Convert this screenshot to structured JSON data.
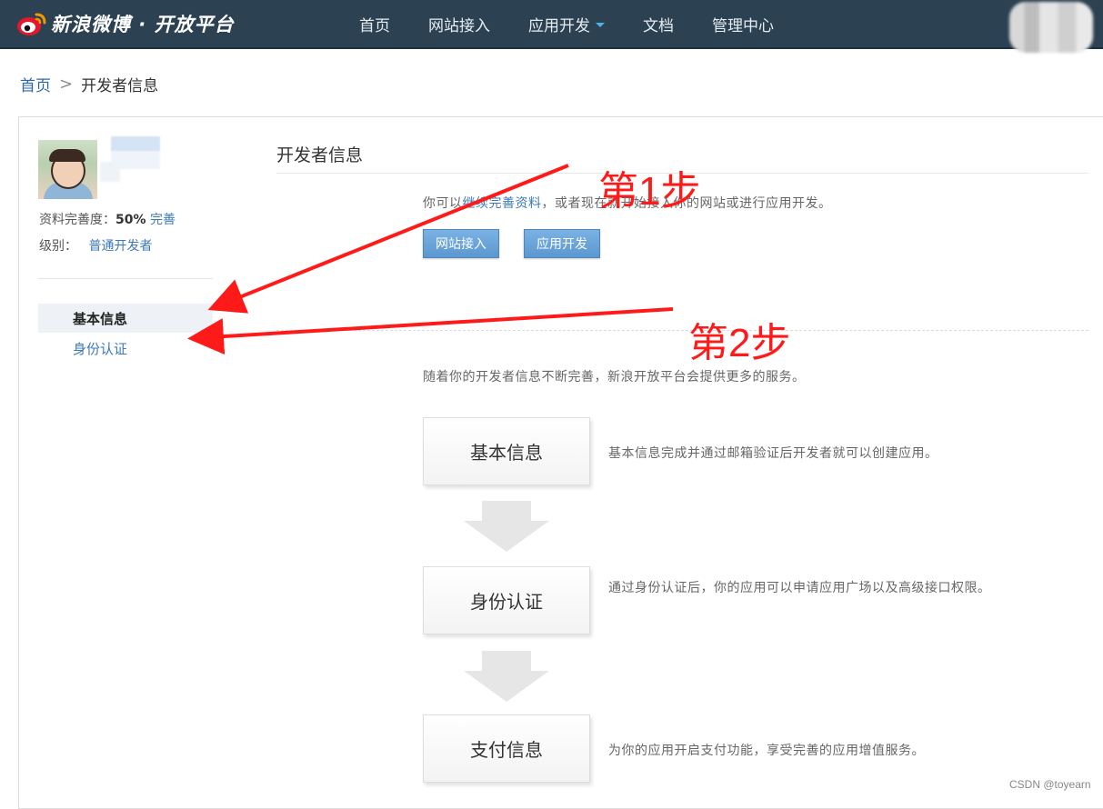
{
  "header": {
    "brand": "新浪微博 · 开放平台",
    "nav": [
      "首页",
      "网站接入",
      "应用开发",
      "文档",
      "管理中心"
    ]
  },
  "breadcrumb": {
    "home": "首页",
    "separator": ">",
    "current": "开发者信息"
  },
  "profile": {
    "completeness_label": "资料完善度：",
    "completeness_value": "50%",
    "completeness_link": "完善",
    "level_label": "级别：",
    "level_value": "普通开发者"
  },
  "sidebar": {
    "items": [
      "基本信息",
      "身份认证"
    ],
    "active_index": 0
  },
  "content": {
    "title": "开发者信息",
    "intro_prefix": "你可以",
    "intro_link": "继续完善资料",
    "intro_suffix": "，或者现在就开始接入你的网站或进行应用开发。",
    "buttons": [
      "网站接入",
      "应用开发"
    ],
    "steps_intro": "随着你的开发者信息不断完善，新浪开放平台会提供更多的服务。",
    "steps": [
      {
        "label": "基本信息",
        "desc": "基本信息完成并通过邮箱验证后开发者就可以创建应用。"
      },
      {
        "label": "身份认证",
        "desc": "通过身份认证后，你的应用可以申请应用广场以及高级接口权限。"
      },
      {
        "label": "支付信息",
        "desc": "为你的应用开启支付功能，享受完善的应用增值服务。"
      }
    ]
  },
  "annotations": {
    "step1": "第1步",
    "step2": "第2步",
    "color": "#ff1a1a"
  },
  "watermark": "CSDN @toyearn",
  "colors": {
    "topbar": "#2c4152",
    "link": "#3d7ab7",
    "button": "#5b97d0"
  }
}
